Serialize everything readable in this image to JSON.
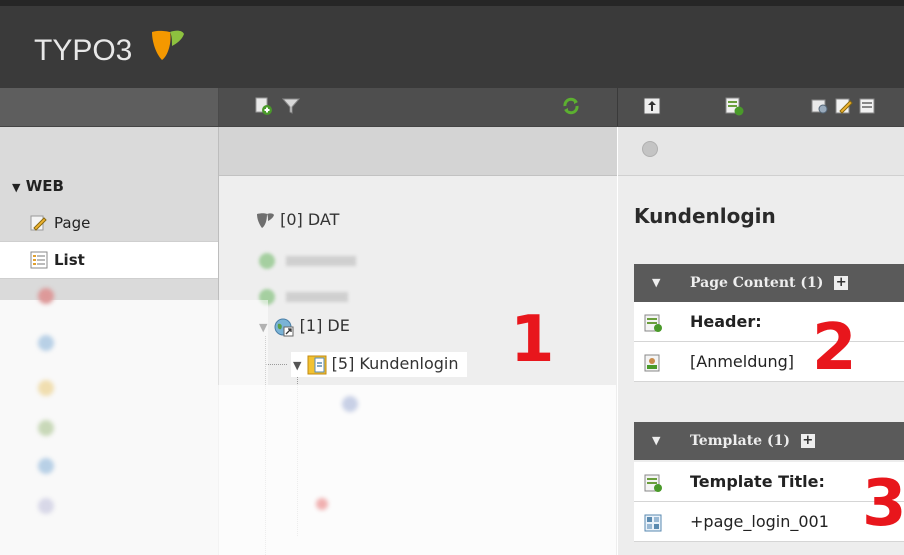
{
  "app": {
    "logo_text": "TYPO3"
  },
  "menu": {
    "section_label": "WEB",
    "items": [
      {
        "label": "Page",
        "icon": "page-edit-icon"
      },
      {
        "label": "List",
        "icon": "list-icon"
      }
    ]
  },
  "tree": {
    "root_label": "[0] DAT",
    "de_label": "[1] DE",
    "kundenlogin_label": "[5] Kundenlogin"
  },
  "content": {
    "page_title": "Kundenlogin",
    "page_content_section": "Page Content (1)",
    "header_label": "Header:",
    "header_value": "[Anmeldung]",
    "template_section": "Template (1)",
    "template_title_label": "Template Title:",
    "template_title_value": "+page_login_001"
  },
  "markers": [
    "1",
    "2",
    "3"
  ],
  "colors": {
    "accent_orange": "#f49800",
    "marker_red": "#e8161c",
    "topbar": "#3a3a3a"
  }
}
